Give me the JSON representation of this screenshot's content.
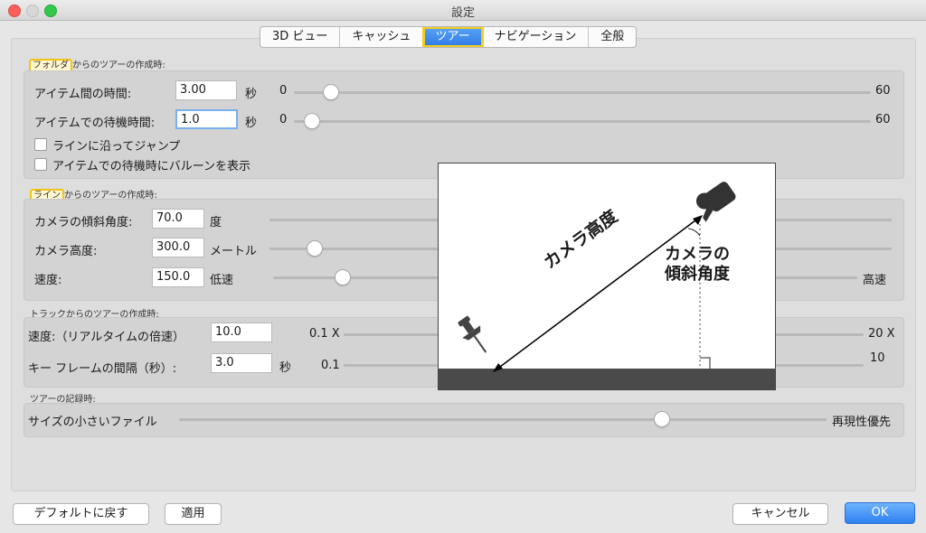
{
  "window": {
    "title": "設定"
  },
  "tabs": [
    {
      "label": "3D ビュー"
    },
    {
      "label": "キャッシュ"
    },
    {
      "label": "ツアー"
    },
    {
      "label": "ナビゲーション"
    },
    {
      "label": "全般"
    }
  ],
  "folder_section": {
    "title_highlight": "フォルダ",
    "title_rest": "からのツアーの作成時:",
    "time_between_label": "アイテム間の時間:",
    "time_between_value": "3.00",
    "time_between_unit": "秒",
    "time_between_min": "0",
    "time_between_max": "60",
    "wait_time_label": "アイテムでの待機時間:",
    "wait_time_value": "1.0",
    "wait_time_unit": "秒",
    "wait_time_min": "0",
    "wait_time_max": "60",
    "fly_along_lines_label": "ラインに沿ってジャンプ",
    "show_balloon_label": "アイテムでの待機時にバルーンを表示"
  },
  "line_section": {
    "title_highlight": "ライン",
    "title_rest": "からのツアーの作成時:",
    "tilt_label": "カメラの傾斜角度:",
    "tilt_value": "70.0",
    "tilt_unit": "度",
    "altitude_label": "カメラ高度:",
    "altitude_value": "300.0",
    "altitude_unit": "メートル",
    "speed_label": "速度:",
    "speed_value": "150.0",
    "speed_min_label": "低速",
    "speed_max_label": "高速"
  },
  "track_section": {
    "title": "トラックからのツアーの作成時:",
    "speed_label": "速度:（リアルタイムの倍速）",
    "speed_value": "10.0",
    "speed_min": "0.1 X",
    "speed_max": "20 X",
    "keyframe_label": "キー フレームの間隔（秒）:",
    "keyframe_value": "3.0",
    "keyframe_unit": "秒",
    "keyframe_min": "0.1",
    "keyframe_max": "10"
  },
  "recording_section": {
    "title": "ツアーの記録時:",
    "min_label": "サイズの小さいファイル",
    "max_label": "再現性優先"
  },
  "diagram": {
    "altitude_caption": "カメラ高度",
    "tilt_caption_line1": "カメラの",
    "tilt_caption_line2": "傾斜角度"
  },
  "buttons": {
    "reset": "デフォルトに戻す",
    "apply": "適用",
    "cancel": "キャンセル",
    "ok": "OK"
  }
}
